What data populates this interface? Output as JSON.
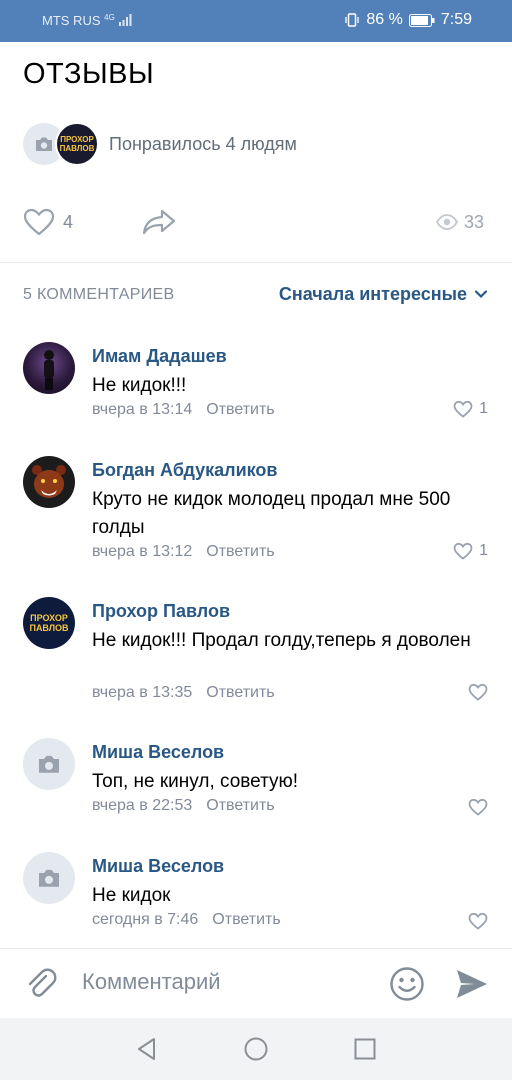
{
  "status_bar": {
    "carrier": "MTS RUS",
    "network": "4G",
    "battery": "86 %",
    "time": "7:59",
    "icons": [
      "signal-icon",
      "vibrate-icon",
      "battery-icon"
    ]
  },
  "page": {
    "title": "ОТЗЫВЫ"
  },
  "likes": {
    "liked_by_text": "Понравилось 4 людям"
  },
  "actions": {
    "like_count": "4",
    "views_count": "33"
  },
  "comments_header": {
    "count_label": "5 КОММЕНТАРИЕВ",
    "sort_label": "Сначала интересные"
  },
  "comments": [
    {
      "author": "Имам Дадашев",
      "text": "Не кидок!!!",
      "time": "вчера в 13:14",
      "reply": "Ответить",
      "likes": "1",
      "avatar": "photo"
    },
    {
      "author": "Богдан Абдукаликов",
      "text": "Круто не кидок молодец продал мне 500 голды",
      "time": "вчера в 13:12",
      "reply": "Ответить",
      "likes": "1",
      "avatar": "bear"
    },
    {
      "author": "Прохор Павлов",
      "text": "Не кидок!!! Продал голду,теперь я доволен",
      "time": "вчера в 13:35",
      "reply": "Ответить",
      "likes": "",
      "avatar": "logo"
    },
    {
      "author": "Миша Веселов",
      "text": "Топ, не кинул, советую!",
      "time": "вчера в 22:53",
      "reply": "Ответить",
      "likes": "",
      "avatar": "camera"
    },
    {
      "author": "Миша Веселов",
      "text": "Не кидок",
      "time": "сегодня в 7:46",
      "reply": "Ответить",
      "likes": "",
      "avatar": "camera"
    }
  ],
  "logo_text": {
    "line1": "ПРОХОР",
    "line2": "ПАВЛОВ"
  },
  "input": {
    "placeholder": "Комментарий"
  },
  "colors": {
    "header": "#5181b8",
    "link": "#2a5885",
    "secondary": "#828a99"
  }
}
